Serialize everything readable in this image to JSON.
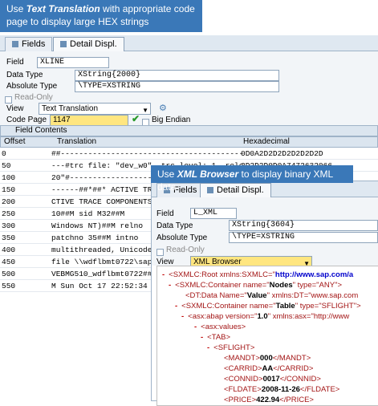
{
  "callout1": {
    "line1_pre": "Use ",
    "line1_em": "Text Translation",
    "line1_post": " with appropriate  code",
    "line2": "page to display large HEX strings"
  },
  "callout2": {
    "pre": "Use ",
    "em": "XML Browser",
    "post": " to display binary XML data"
  },
  "panel1": {
    "tabs": [
      "Fields",
      "Detail Displ."
    ],
    "field_label": "Field",
    "field_value": "XLINE",
    "datatype_label": "Data Type",
    "datatype_value": "XString{2000}",
    "abstype_label": "Absolute Type",
    "abstype_value": "\\TYPE=XSTRING",
    "readonly_label": "Read-Only",
    "view_label": "View",
    "view_value": "Text Translation",
    "codepage_label": "Code Page",
    "codepage_value": "1147",
    "bigendian_label": "Big Endian",
    "grid_title": "Field Contents",
    "columns": [
      "Offset",
      "Translation",
      "Hexadecimal"
    ],
    "rows": [
      {
        "off": "0",
        "tr": "##-----------------------------------------------",
        "hex": "0D0A2D2D2D2D2D2D2D"
      },
      {
        "off": "50",
        "tr": "---#trc file: \"dev_w0\", trc level: 1, release: \"7",
        "hex": "2D2D2D0D0A7472632066"
      },
      {
        "off": "100",
        "tr": "20\"#-------------------------------------------",
        "hex": ""
      },
      {
        "off": "150",
        "tr": "------##*##*  ACTIVE TRACE",
        "hex": ""
      },
      {
        "off": "200",
        "tr": "CTIVE TRACE COMPONENTS",
        "hex": ""
      },
      {
        "off": "250",
        "tr": "    10##M sid        M32##M",
        "hex": ""
      },
      {
        "off": "300",
        "tr": " Windows NT)##M relno",
        "hex": ""
      },
      {
        "off": "350",
        "tr": " patchno     35##M intno",
        "hex": ""
      },
      {
        "off": "400",
        "tr": " multithreaded, Unicode,",
        "hex": ""
      },
      {
        "off": "450",
        "tr": "file    \\\\wdflbmt0722\\sapm",
        "hex": ""
      },
      {
        "off": "500",
        "tr": "VEBMG510_wdflbmt0722##M pi",
        "hex": ""
      },
      {
        "off": "550",
        "tr": "M Sun Oct 17 22:52:34 2010",
        "hex": ""
      }
    ]
  },
  "panel2": {
    "tabs": [
      "Fields",
      "Detail Displ."
    ],
    "field_label": "Field",
    "field_value": "L_XML",
    "datatype_label": "Data Type",
    "datatype_value": "XString{3604}",
    "abstype_label": "Absolute Type",
    "abstype_value": "\\TYPE=XSTRING",
    "readonly_label": "Read-Only",
    "view_label": "View",
    "view_value": "XML Browser",
    "xml": [
      {
        "min": "-",
        "pre": "<SXMLC:Root xmlns:SXMLC=\"",
        "hl": "http://www.sap.com/a",
        "post": ""
      },
      {
        "min": "-",
        "pre": "<SXMLC:Container name=\"",
        "hl": "Nodes",
        "post": "\" type=\"ANY\">"
      },
      {
        "min": "",
        "pre": "<DT:Data Name=\"",
        "hl": "Value",
        "post": "\" xmlns:DT=\"www.sap.com"
      },
      {
        "min": "-",
        "pre": "<SXMLC:Container name=\"",
        "hl": "Table",
        "post": "\" type=\"SFLIGHT\">"
      },
      {
        "min": "-",
        "pre": "<asx:abap version=\"",
        "hl": "1.0",
        "post": "\" xmlns:asx=\"http://www"
      },
      {
        "min": "-",
        "pre": "<asx:values>",
        "hl": "",
        "post": ""
      },
      {
        "min": "-",
        "pre": "<TAB>",
        "hl": "",
        "post": ""
      },
      {
        "min": "-",
        "pre": "<SFLIGHT>",
        "hl": "",
        "post": ""
      },
      {
        "min": "",
        "pre": "<MANDT>",
        "hl": "000",
        "post": "</MANDT>"
      },
      {
        "min": "",
        "pre": "<CARRID>",
        "hl": "AA",
        "post": "</CARRID>"
      },
      {
        "min": "",
        "pre": "<CONNID>",
        "hl": "0017",
        "post": "</CONNID>"
      },
      {
        "min": "",
        "pre": "<FLDATE>",
        "hl": "2008-11-26",
        "post": "</FLDATE>"
      },
      {
        "min": "",
        "pre": "<PRICE>",
        "hl": "422.94",
        "post": "</PRICE>"
      }
    ]
  }
}
